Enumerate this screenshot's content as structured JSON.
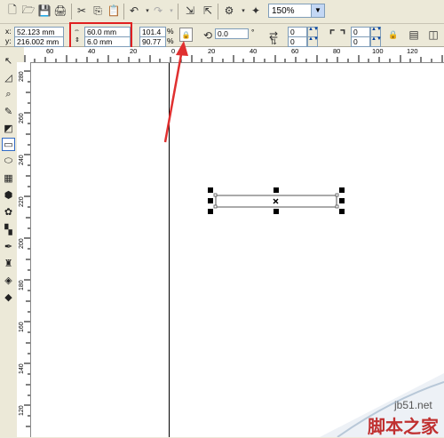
{
  "toolbar": {
    "zoom": "150%",
    "x_label": "x:",
    "x_value": "52.123 mm",
    "y_label": "y:",
    "y_value": "216.002 mm",
    "width_value": "60.0 mm",
    "height_value": "6.0 mm",
    "scale_x": "101.4",
    "scale_y": "90.77",
    "pct": "%",
    "rotation": "0.0",
    "degree": "°",
    "corner_values": [
      "0",
      "0",
      "0",
      "0"
    ]
  },
  "ruler": {
    "h_ticks": [
      "60",
      "40",
      "20",
      "0",
      "20",
      "40",
      "60",
      "80",
      "100",
      "120"
    ],
    "v_ticks": [
      "280",
      "260",
      "240",
      "220",
      "200",
      "180",
      "160",
      "140",
      "120"
    ]
  },
  "watermark": {
    "url": "jb51.net",
    "text": "脚本之家"
  },
  "colors": {
    "highlight_box": "#e02020",
    "arrow": "#e03030",
    "selection_handle": "#000000"
  }
}
